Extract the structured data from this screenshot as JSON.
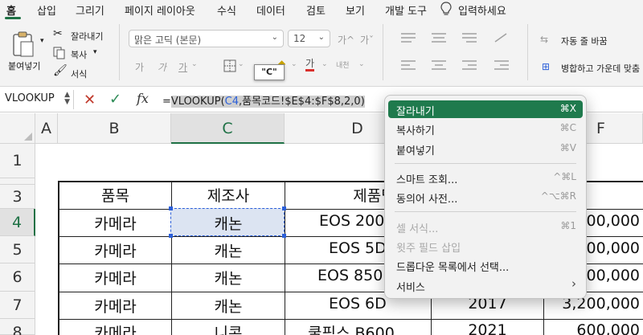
{
  "ribbon_tabs": [
    "홈",
    "삽입",
    "그리기",
    "페이지 레이아웃",
    "수식",
    "데이터",
    "검토",
    "보기",
    "개발 도구",
    "입력하세요"
  ],
  "clipboard": {
    "cut": "잘라내기",
    "copy": "복사",
    "format": "서식",
    "paste": "붙여넣기"
  },
  "font": {
    "name": "맑은 고딕 (본문)",
    "size": "12",
    "grow": "가^",
    "shrink": "가ˇ",
    "bold": "가",
    "italic": "가",
    "underline": "가",
    "color": "가",
    "phonetic": "내천"
  },
  "alignment": {
    "wrap": "자동 줄 바꿈",
    "merge": "병합하고 가운데 맞춤"
  },
  "tooltip": "\"C\"",
  "formula_bar": {
    "name_box": "VLOOKUP",
    "formula_prefix": "=",
    "formula_head": "VLOOKUP(",
    "formula_ref": "C4",
    "formula_tail": ",품목코드!$E$4:$F$8,2,0)"
  },
  "columns": [
    "A",
    "B",
    "C",
    "D",
    "E",
    "F"
  ],
  "rows": [
    "1",
    "2",
    "3",
    "4",
    "5",
    "6",
    "7",
    "8"
  ],
  "table": {
    "headers": [
      "품목",
      "제조사",
      "제품명"
    ],
    "rows": [
      {
        "item": "카메라",
        "maker": "캐논",
        "product": "EOS 200",
        "year": "",
        "price": "900,000"
      },
      {
        "item": "카메라",
        "maker": "캐논",
        "product": "EOS 5D",
        "year": "",
        "price": "500,000"
      },
      {
        "item": "카메라",
        "maker": "캐논",
        "product": "EOS 850",
        "year": "",
        "price": "300,000"
      },
      {
        "item": "카메라",
        "maker": "캐논",
        "product": "EOS 6D",
        "year": "2017",
        "price": "3,200,000"
      },
      {
        "item": "카메라",
        "maker": "니콘",
        "product": "쿨픽스 B600",
        "year": "2021",
        "price": "600,000"
      }
    ]
  },
  "context_menu": {
    "items": [
      {
        "label": "잘라내기",
        "shortcut": "⌘X",
        "state": "active"
      },
      {
        "label": "복사하기",
        "shortcut": "⌘C",
        "state": "normal"
      },
      {
        "label": "붙여넣기",
        "shortcut": "⌘V",
        "state": "normal"
      },
      {
        "label": "스마트 조회...",
        "shortcut": "^⌘L",
        "state": "normal"
      },
      {
        "label": "동의어 사전...",
        "shortcut": "^⌥⌘R",
        "state": "normal"
      },
      {
        "label": "셀 서식...",
        "shortcut": "⌘1",
        "state": "disabled"
      },
      {
        "label": "윗주 필드 삽입",
        "shortcut": "",
        "state": "disabled"
      },
      {
        "label": "드롭다운 목록에서 선택...",
        "shortcut": "",
        "state": "normal"
      },
      {
        "label": "서비스",
        "shortcut": "›",
        "state": "normal"
      }
    ]
  },
  "colors": {
    "accent": "#1e7145",
    "menu_highlight": "#1f7a4d",
    "selection_fill": "#dce4f2",
    "reference_blue": "#2b5fd9"
  }
}
